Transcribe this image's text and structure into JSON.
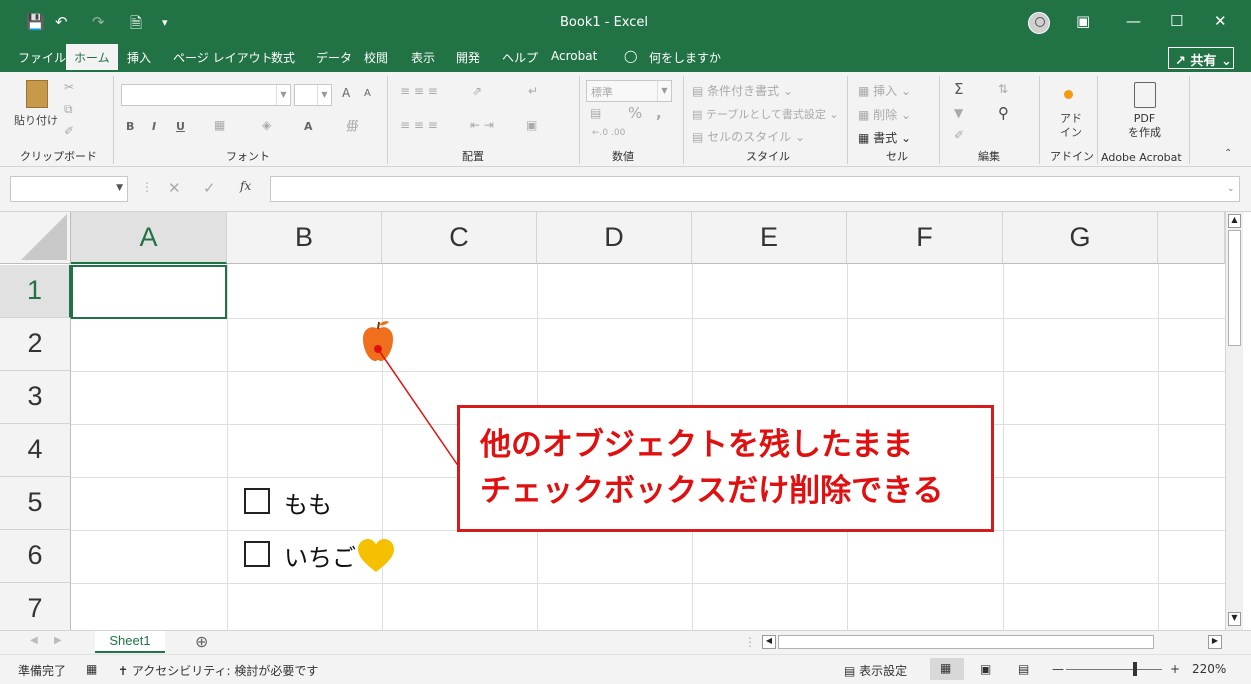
{
  "title_bar": {
    "title": "Book1  -  Excel",
    "save_icon": "save-icon",
    "undo_icon": "undo-icon",
    "redo_icon": "redo-icon",
    "new_icon": "new-document-icon"
  },
  "menu": {
    "tabs": [
      "ファイル",
      "ホーム",
      "挿入",
      "ページ レイアウト",
      "数式",
      "データ",
      "校閲",
      "表示",
      "開発",
      "ヘルプ",
      "Acrobat"
    ],
    "active_tab": "ホーム",
    "tell_me": "何をしますか",
    "share": "共有"
  },
  "ribbon": {
    "clipboard": {
      "paste": "貼り付け",
      "label": "クリップボード"
    },
    "font": {
      "label": "フォント",
      "bold": "B",
      "italic": "I",
      "underline": "U",
      "grow": "A",
      "shrink": "A",
      "color": "A"
    },
    "alignment": {
      "label": "配置"
    },
    "number": {
      "format": "標準",
      "percent": "%",
      "comma": ",",
      "label": "数値"
    },
    "styles": {
      "conditional": "条件付き書式",
      "table": "テーブルとして書式設定",
      "cell_styles": "セルのスタイル",
      "label": "スタイル"
    },
    "cells": {
      "insert": "挿入",
      "delete": "削除",
      "format": "書式",
      "label": "セル"
    },
    "editing": {
      "label": "編集",
      "sum": "Σ"
    },
    "addins": {
      "button": "アド\nイン",
      "label": "アドイン"
    },
    "acrobat": {
      "button": "PDF\nを作成",
      "label": "Adobe Acrobat"
    }
  },
  "formula_bar": {
    "name_box": "",
    "fx": "fx",
    "formula": ""
  },
  "grid": {
    "columns": [
      "A",
      "B",
      "C",
      "D",
      "E",
      "F",
      "G"
    ],
    "rows": [
      "1",
      "2",
      "3",
      "4",
      "5",
      "6",
      "7"
    ],
    "selected_cell": "A1"
  },
  "checkboxes": [
    {
      "label": "もも",
      "checked": false
    },
    {
      "label": "いちご",
      "checked": false
    }
  ],
  "objects": {
    "apple": "apple-icon",
    "heart": "heart-icon"
  },
  "callout": {
    "line1": "他のオブジェクトを残したまま",
    "line2": "チェックボックスだけ削除できる"
  },
  "sheet_tabs": [
    "Sheet1"
  ],
  "status": {
    "ready": "準備完了",
    "accessibility": "アクセシビリティ: 検討が必要です",
    "display_settings": "表示設定",
    "zoom": "220%"
  },
  "colors": {
    "excel_green": "#217346",
    "callout_red": "#e01010"
  }
}
